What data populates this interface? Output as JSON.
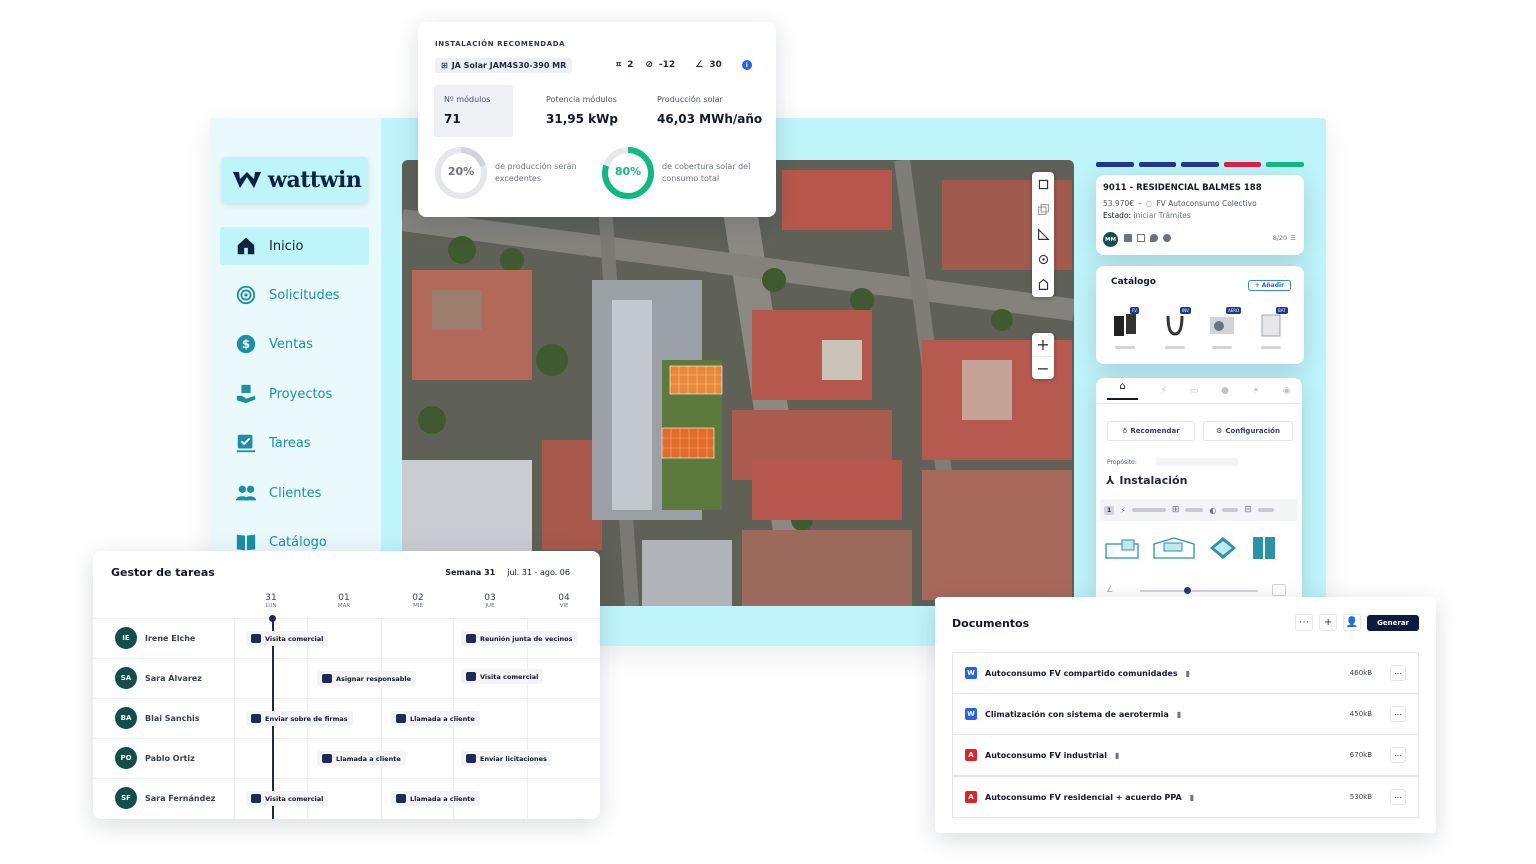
{
  "brand": {
    "logo_text": "wattwin"
  },
  "sidebar": {
    "items": [
      {
        "label": "Inicio",
        "icon": "home-icon",
        "active": true
      },
      {
        "label": "Solicitudes",
        "icon": "target-icon"
      },
      {
        "label": "Ventas",
        "icon": "dollar-icon"
      },
      {
        "label": "Proyectos",
        "icon": "projects-icon"
      },
      {
        "label": "Tareas",
        "icon": "tasks-icon"
      },
      {
        "label": "Clientes",
        "icon": "users-icon"
      },
      {
        "label": "Catálogo",
        "icon": "book-icon"
      }
    ]
  },
  "install": {
    "caption": "INSTALACIÓN RECOMENDADA",
    "module_model": "JA Solar JAM4S30-390 MR",
    "param1": "2",
    "param2": "-12",
    "param3": "30",
    "stats": [
      {
        "label": "Nº módulos",
        "value": "71"
      },
      {
        "label": "Potencia módulos",
        "value": "31,95 kWp"
      },
      {
        "label": "Producción solar",
        "value": "46,03 MWh/año"
      }
    ],
    "ring1": {
      "percent": "20%",
      "fraction": 0.2,
      "text_line1": "de producción serán",
      "text_line2": "excedentes"
    },
    "ring2": {
      "percent": "80%",
      "fraction": 0.8,
      "text_line1": "de cobertura solar del",
      "text_line2": "consumo total"
    }
  },
  "project": {
    "title": "9011 - RESIDENCIAL BALMES 188",
    "price": "53.970€",
    "type": "FV Autoconsumo Colectivo",
    "status_label": "Estado:",
    "status_value": "Iniciar Trámites",
    "owner_initials": "MM",
    "progress": "8/20",
    "strip_colors": [
      "#1e3a8a",
      "#1e3a8a",
      "#1e3a8a",
      "#e11d48",
      "#10b981"
    ]
  },
  "catalog": {
    "title": "Catálogo",
    "add_label": "+ Añadir",
    "badges": [
      "FV",
      "INV",
      "AERO",
      "BAT"
    ]
  },
  "config": {
    "recommend_label": "Recomendar",
    "config_label": "Configuración",
    "purpose_label": "Propósito:",
    "section_title": "Instalación",
    "first_num": "1"
  },
  "tasks": {
    "title": "Gestor de tareas",
    "week_label": "Semana 31",
    "week_range": "jul. 31 - ago. 06",
    "days": [
      {
        "num": "31",
        "lab": "LUN"
      },
      {
        "num": "01",
        "lab": "MAR"
      },
      {
        "num": "02",
        "lab": "MIE"
      },
      {
        "num": "03",
        "lab": "JUE"
      },
      {
        "num": "04",
        "lab": "VIE"
      }
    ],
    "people": [
      {
        "initials": "IE",
        "name": "Irene Elche"
      },
      {
        "initials": "SA",
        "name": "Sara Álvarez"
      },
      {
        "initials": "BA",
        "name": "Blai Sanchis"
      },
      {
        "initials": "PO",
        "name": "Pablo Ortiz"
      },
      {
        "initials": "SF",
        "name": "Sara Fernández"
      }
    ],
    "chips": [
      "Visita comercial",
      "Reunión junta de vecinos",
      "Asignar responsable",
      "Visita comercial",
      "Enviar sobre de firmas",
      "Llamada a cliente",
      "Llamada a cliente",
      "Enviar licitaciones",
      "Visita comercial",
      "Llamada a cliente"
    ]
  },
  "documents": {
    "title": "Documentos",
    "generate_label": "Generar",
    "items": [
      {
        "name": "Autoconsumo FV compartido comunidades",
        "size": "460kB",
        "type": "word"
      },
      {
        "name": "Climatización con sistema de aerotermia",
        "size": "450kB",
        "type": "word"
      },
      {
        "name": "Autoconsumo FV industrial",
        "size": "670kB",
        "type": "pdf"
      },
      {
        "name": "Autoconsumo FV residencial + acuerdo PPA",
        "size": "530kB",
        "type": "pdf"
      }
    ]
  },
  "colors": {
    "brand_dark": "#0b2540",
    "accent_cyan": "#bff4fa",
    "nav_text": "#1a8fa6",
    "ring_green": "#10b981",
    "word_blue": "#2563eb",
    "pdf_red": "#dc2626"
  }
}
